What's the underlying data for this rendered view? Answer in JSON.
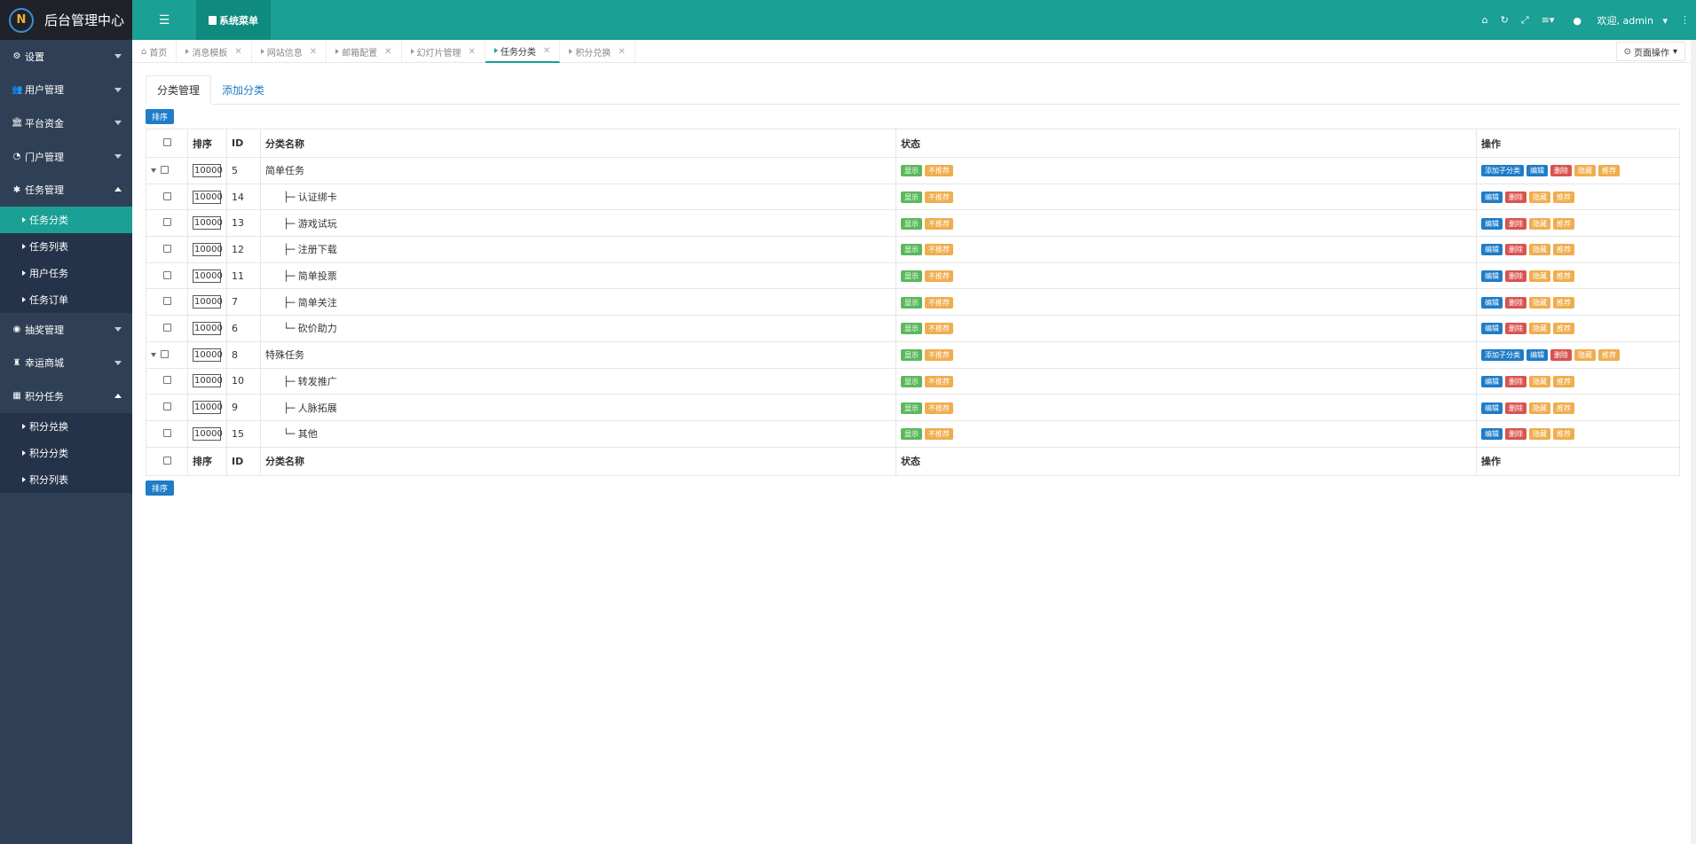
{
  "app": {
    "title": "后台管理中心",
    "logo_letters": "N"
  },
  "topbar": {
    "sysmenu_label": "系统菜单",
    "welcome": "欢迎, admin"
  },
  "sidebar": {
    "items": [
      {
        "label": "设置",
        "expanded": false
      },
      {
        "label": "用户管理",
        "expanded": false
      },
      {
        "label": "平台资金",
        "expanded": false
      },
      {
        "label": "门户管理",
        "expanded": false
      },
      {
        "label": "任务管理",
        "expanded": true,
        "children": [
          "任务分类",
          "任务列表",
          "用户任务",
          "任务订单"
        ]
      },
      {
        "label": "抽奖管理",
        "expanded": false
      },
      {
        "label": "幸运商城",
        "expanded": false
      },
      {
        "label": "积分任务",
        "expanded": true,
        "children": [
          "积分兑换",
          "积分分类",
          "积分列表"
        ]
      }
    ],
    "active_child": "任务分类"
  },
  "tabs": [
    {
      "label": "首页",
      "closable": false
    },
    {
      "label": "消息模板",
      "closable": true
    },
    {
      "label": "网站信息",
      "closable": true
    },
    {
      "label": "邮箱配置",
      "closable": true
    },
    {
      "label": "幻灯片管理",
      "closable": true
    },
    {
      "label": "任务分类",
      "closable": true,
      "active": true
    },
    {
      "label": "积分兑换",
      "closable": true
    }
  ],
  "page_ops_label": "页面操作",
  "content": {
    "tabs": [
      "分类管理",
      "添加分类"
    ],
    "sort_button": "排序",
    "columns": [
      "排序",
      "ID",
      "分类名称",
      "状态",
      "操作"
    ],
    "rows": [
      {
        "order": "10000",
        "id": "5",
        "name": "简单任务",
        "parent": true
      },
      {
        "order": "10000",
        "id": "14",
        "name": "├─ 认证绑卡",
        "parent": false
      },
      {
        "order": "10000",
        "id": "13",
        "name": "├─ 游戏试玩",
        "parent": false
      },
      {
        "order": "10000",
        "id": "12",
        "name": "├─ 注册下载",
        "parent": false
      },
      {
        "order": "10000",
        "id": "11",
        "name": "├─ 简单投票",
        "parent": false
      },
      {
        "order": "10000",
        "id": "7",
        "name": "├─ 简单关注",
        "parent": false
      },
      {
        "order": "10000",
        "id": "6",
        "name": "└─ 砍价助力",
        "parent": false
      },
      {
        "order": "10000",
        "id": "8",
        "name": "特殊任务",
        "parent": true
      },
      {
        "order": "10000",
        "id": "10",
        "name": "├─ 转发推广",
        "parent": false
      },
      {
        "order": "10000",
        "id": "9",
        "name": "├─ 人脉拓展",
        "parent": false
      },
      {
        "order": "10000",
        "id": "15",
        "name": "└─ 其他",
        "parent": false
      }
    ],
    "status_labels": {
      "show": "显示",
      "not_recommended": "不推荐"
    },
    "action_labels": {
      "add_child": "添加子分类",
      "edit": "编辑",
      "delete": "删除",
      "hide": "隐藏",
      "recommend": "推荐"
    }
  },
  "colors": {
    "brand": "#1aa094",
    "sidebar": "#2f4056",
    "primary": "#1e7cc8",
    "danger": "#d9534f",
    "warning": "#f0ad4e",
    "success": "#5cb85c"
  }
}
